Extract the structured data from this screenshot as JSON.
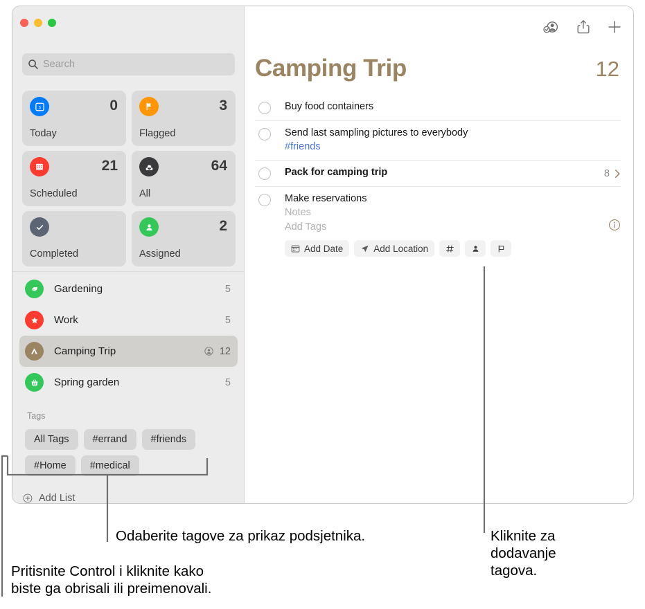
{
  "window": {
    "traffic_lights": [
      "close",
      "minimize",
      "zoom"
    ],
    "accent_color": "#9b8462"
  },
  "sidebar": {
    "search": {
      "placeholder": "Search",
      "value": "",
      "icon": "search-icon"
    },
    "smart_lists": [
      {
        "label": "Today",
        "count": "0",
        "icon": "calendar-today-icon",
        "color": "#007aff"
      },
      {
        "label": "Flagged",
        "count": "3",
        "icon": "flag-icon",
        "color": "#ff9500"
      },
      {
        "label": "Scheduled",
        "count": "21",
        "icon": "calendar-icon",
        "color": "#ff3b30"
      },
      {
        "label": "All",
        "count": "64",
        "icon": "inbox-icon",
        "color": "#3a3a3c"
      },
      {
        "label": "Completed",
        "count": "",
        "icon": "checkmark-icon",
        "color": "#5b6573"
      },
      {
        "label": "Assigned",
        "count": "2",
        "icon": "person-icon",
        "color": "#34c759"
      }
    ],
    "lists": [
      {
        "label": "Gardening",
        "count": "5",
        "icon": "leaf-icon",
        "color": "#34c759",
        "selected": false,
        "shared": false
      },
      {
        "label": "Work",
        "count": "5",
        "icon": "star-icon",
        "color": "#ff3b30",
        "selected": false,
        "shared": false
      },
      {
        "label": "Camping Trip",
        "count": "12",
        "icon": "tent-icon",
        "color": "#9b8462",
        "selected": true,
        "shared": true
      },
      {
        "label": "Spring garden",
        "count": "5",
        "icon": "basket-icon",
        "color": "#34c759",
        "selected": false,
        "shared": false
      }
    ],
    "tags_header": "Tags",
    "tags": [
      "All Tags",
      "#errand",
      "#friends",
      "#Home",
      "#medical"
    ],
    "add_list_label": "Add List",
    "add_list_icon": "plus-circle-icon"
  },
  "main": {
    "toolbar": [
      {
        "name": "shared-list-button",
        "icon": "person-badge-check-icon"
      },
      {
        "name": "share-button",
        "icon": "share-icon"
      },
      {
        "name": "add-reminder-button",
        "icon": "plus-icon"
      }
    ],
    "title": "Camping Trip",
    "count": "12",
    "reminders": [
      {
        "title": "Buy food containers",
        "bold": false,
        "tag": "",
        "sub_count": "",
        "chevron": false,
        "info": false,
        "editing": false
      },
      {
        "title": "Send last sampling pictures to everybody",
        "bold": false,
        "tag": "#friends",
        "sub_count": "",
        "chevron": false,
        "info": false,
        "editing": false
      },
      {
        "title": "Pack for camping trip",
        "bold": true,
        "tag": "",
        "sub_count": "8",
        "chevron": true,
        "info": false,
        "editing": false
      },
      {
        "title": "Make reservations",
        "bold": false,
        "tag": "",
        "sub_count": "",
        "chevron": false,
        "info": true,
        "editing": true,
        "notes_placeholder": "Notes",
        "tags_placeholder": "Add Tags",
        "quick_buttons": [
          {
            "label": "Add Date",
            "icon": "calendar-icon"
          },
          {
            "label": "Add Location",
            "icon": "location-arrow-icon"
          },
          {
            "label": "",
            "icon": "hashtag-icon"
          },
          {
            "label": "",
            "icon": "person-icon"
          },
          {
            "label": "",
            "icon": "flag-outline-icon"
          }
        ]
      }
    ]
  },
  "callouts": [
    {
      "name": "callout-tags-select",
      "text": "Odaberite tagove za prikaz podsjetnika."
    },
    {
      "name": "callout-add-tags",
      "text": "Kliknite za\ndodavanje\ntagova."
    },
    {
      "name": "callout-control-click",
      "text": "Pritisnite Control i kliknite kako\nbiste ga obrisali ili preimenovali."
    }
  ]
}
